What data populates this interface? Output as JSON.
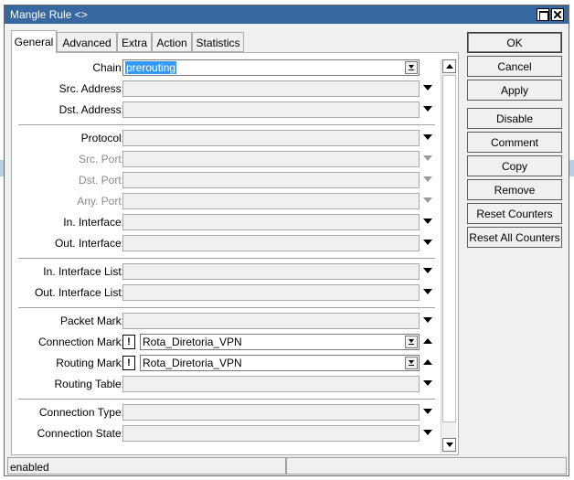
{
  "window": {
    "title": "Mangle Rule <>"
  },
  "tabs": [
    {
      "label": "General",
      "active": true
    },
    {
      "label": "Advanced",
      "active": false
    },
    {
      "label": "Extra",
      "active": false
    },
    {
      "label": "Action",
      "active": false
    },
    {
      "label": "Statistics",
      "active": false
    }
  ],
  "fields": {
    "chain": {
      "label": "Chain:",
      "value": "prerouting"
    },
    "src_address": {
      "label": "Src. Address:",
      "value": ""
    },
    "dst_address": {
      "label": "Dst. Address:",
      "value": ""
    },
    "protocol": {
      "label": "Protocol:",
      "value": ""
    },
    "src_port": {
      "label": "Src. Port:",
      "value": "",
      "disabled": true
    },
    "dst_port": {
      "label": "Dst. Port:",
      "value": "",
      "disabled": true
    },
    "any_port": {
      "label": "Any. Port:",
      "value": "",
      "disabled": true
    },
    "in_interface": {
      "label": "In. Interface:",
      "value": ""
    },
    "out_interface": {
      "label": "Out. Interface:",
      "value": ""
    },
    "in_interface_list": {
      "label": "In. Interface List:",
      "value": ""
    },
    "out_interface_list": {
      "label": "Out. Interface List:",
      "value": ""
    },
    "packet_mark": {
      "label": "Packet Mark:",
      "value": ""
    },
    "connection_mark": {
      "label": "Connection Mark:",
      "negate": "!",
      "value": "Rota_Diretoria_VPN"
    },
    "routing_mark": {
      "label": "Routing Mark:",
      "negate": "!",
      "value": "Rota_Diretoria_VPN"
    },
    "routing_table": {
      "label": "Routing Table:",
      "value": ""
    },
    "connection_type": {
      "label": "Connection Type:",
      "value": ""
    },
    "connection_state": {
      "label": "Connection State:",
      "value": ""
    }
  },
  "buttons": {
    "ok": "OK",
    "cancel": "Cancel",
    "apply": "Apply",
    "disable": "Disable",
    "comment": "Comment",
    "copy": "Copy",
    "remove": "Remove",
    "reset_counters": "Reset Counters",
    "reset_all_counters": "Reset All Counters"
  },
  "status": {
    "text": "enabled"
  },
  "colors": {
    "titlebar": "#3768a0",
    "selection": "#3399ff"
  }
}
